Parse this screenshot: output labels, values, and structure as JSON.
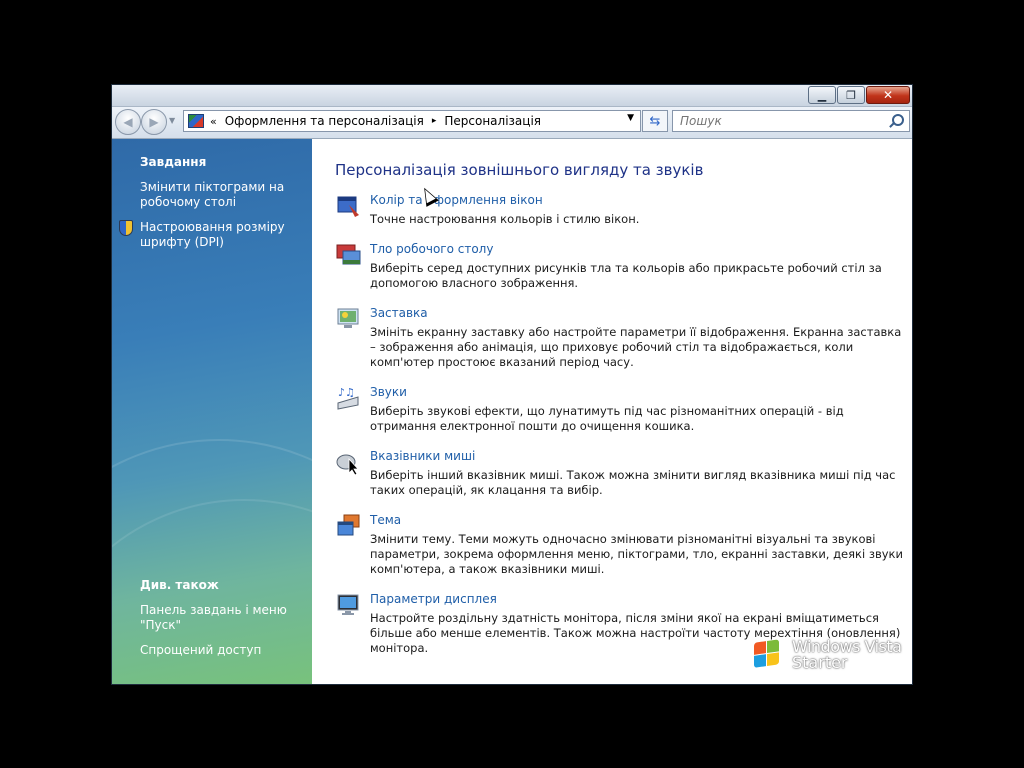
{
  "titlebar": {
    "minimize_icon": "minimize-icon",
    "maximize_icon": "restore-icon",
    "close_icon": "close-icon"
  },
  "navbar": {
    "back_icon": "back-arrow-icon",
    "forward_icon": "forward-arrow-icon",
    "breadcrumb_prefix": "«",
    "breadcrumbs": [
      "Оформлення та персоналізація",
      "Персоналізація"
    ],
    "breadcrumb_separator": "▸",
    "search_placeholder": "Пошук",
    "refresh_icon": "refresh-icon"
  },
  "sidebar": {
    "tasks_heading": "Завдання",
    "tasks": [
      {
        "label": "Змінити піктограми на робочому столі"
      },
      {
        "label": "Настроювання розміру шрифту (DPI)",
        "icon": "uac-shield-icon"
      }
    ],
    "see_also_heading": "Див. також",
    "see_also": [
      {
        "label": "Панель завдань і меню \"Пуск\""
      },
      {
        "label": "Спрощений доступ"
      }
    ]
  },
  "main": {
    "title": "Персоналізація зовнішнього вигляду та звуків",
    "items": [
      {
        "link": "Колір та оформлення вікон",
        "desc": "Точне настроювання кольорів і стилю вікон.",
        "icon": "window-color-icon"
      },
      {
        "link": "Тло робочого столу",
        "desc": "Виберіть серед доступних рисунків тла та кольорів або прикрасьте робочий стіл за допомогою власного зображення.",
        "icon": "desktop-background-icon"
      },
      {
        "link": "Заставка",
        "desc": "Змініть екранну заставку або настройте параметри її відображення. Екранна заставка – зображення або анімація, що приховує робочий стіл та відображається, коли комп'ютер простоює вказаний період часу.",
        "icon": "screensaver-icon"
      },
      {
        "link": "Звуки",
        "desc": "Виберіть звукові ефекти, що лунатимуть під час різноманітних операцій - від отримання електронної пошти до очищення кошика.",
        "icon": "sounds-icon"
      },
      {
        "link": "Вказівники миші",
        "desc": "Виберіть інший вказівник миші. Також можна змінити вигляд вказівника миші під час таких операцій, як клацання та вибір.",
        "icon": "mouse-pointer-icon"
      },
      {
        "link": "Тема",
        "desc": "Змінити тему. Теми можуть одночасно змінювати різноманітні візуальні та звукові параметри, зокрема оформлення меню, піктограми, тло, екранні заставки, деякі звуки комп'ютера, а також вказівники миші.",
        "icon": "theme-icon"
      },
      {
        "link": "Параметри дисплея",
        "desc": "Настройте роздільну здатність монітора, після зміни якої на екрані вміщатиметься більше або менше елементів. Також можна настроїти частоту мерехтіння (оновлення) монітора.",
        "icon": "display-settings-icon"
      }
    ]
  },
  "watermark": {
    "line1": "Windows Vista",
    "line2": "Starter"
  },
  "colors": {
    "link": "#1f5ea8",
    "title": "#1e3287",
    "sidebar_top": "#2f6aa8",
    "sidebar_bottom": "#78c27c"
  }
}
